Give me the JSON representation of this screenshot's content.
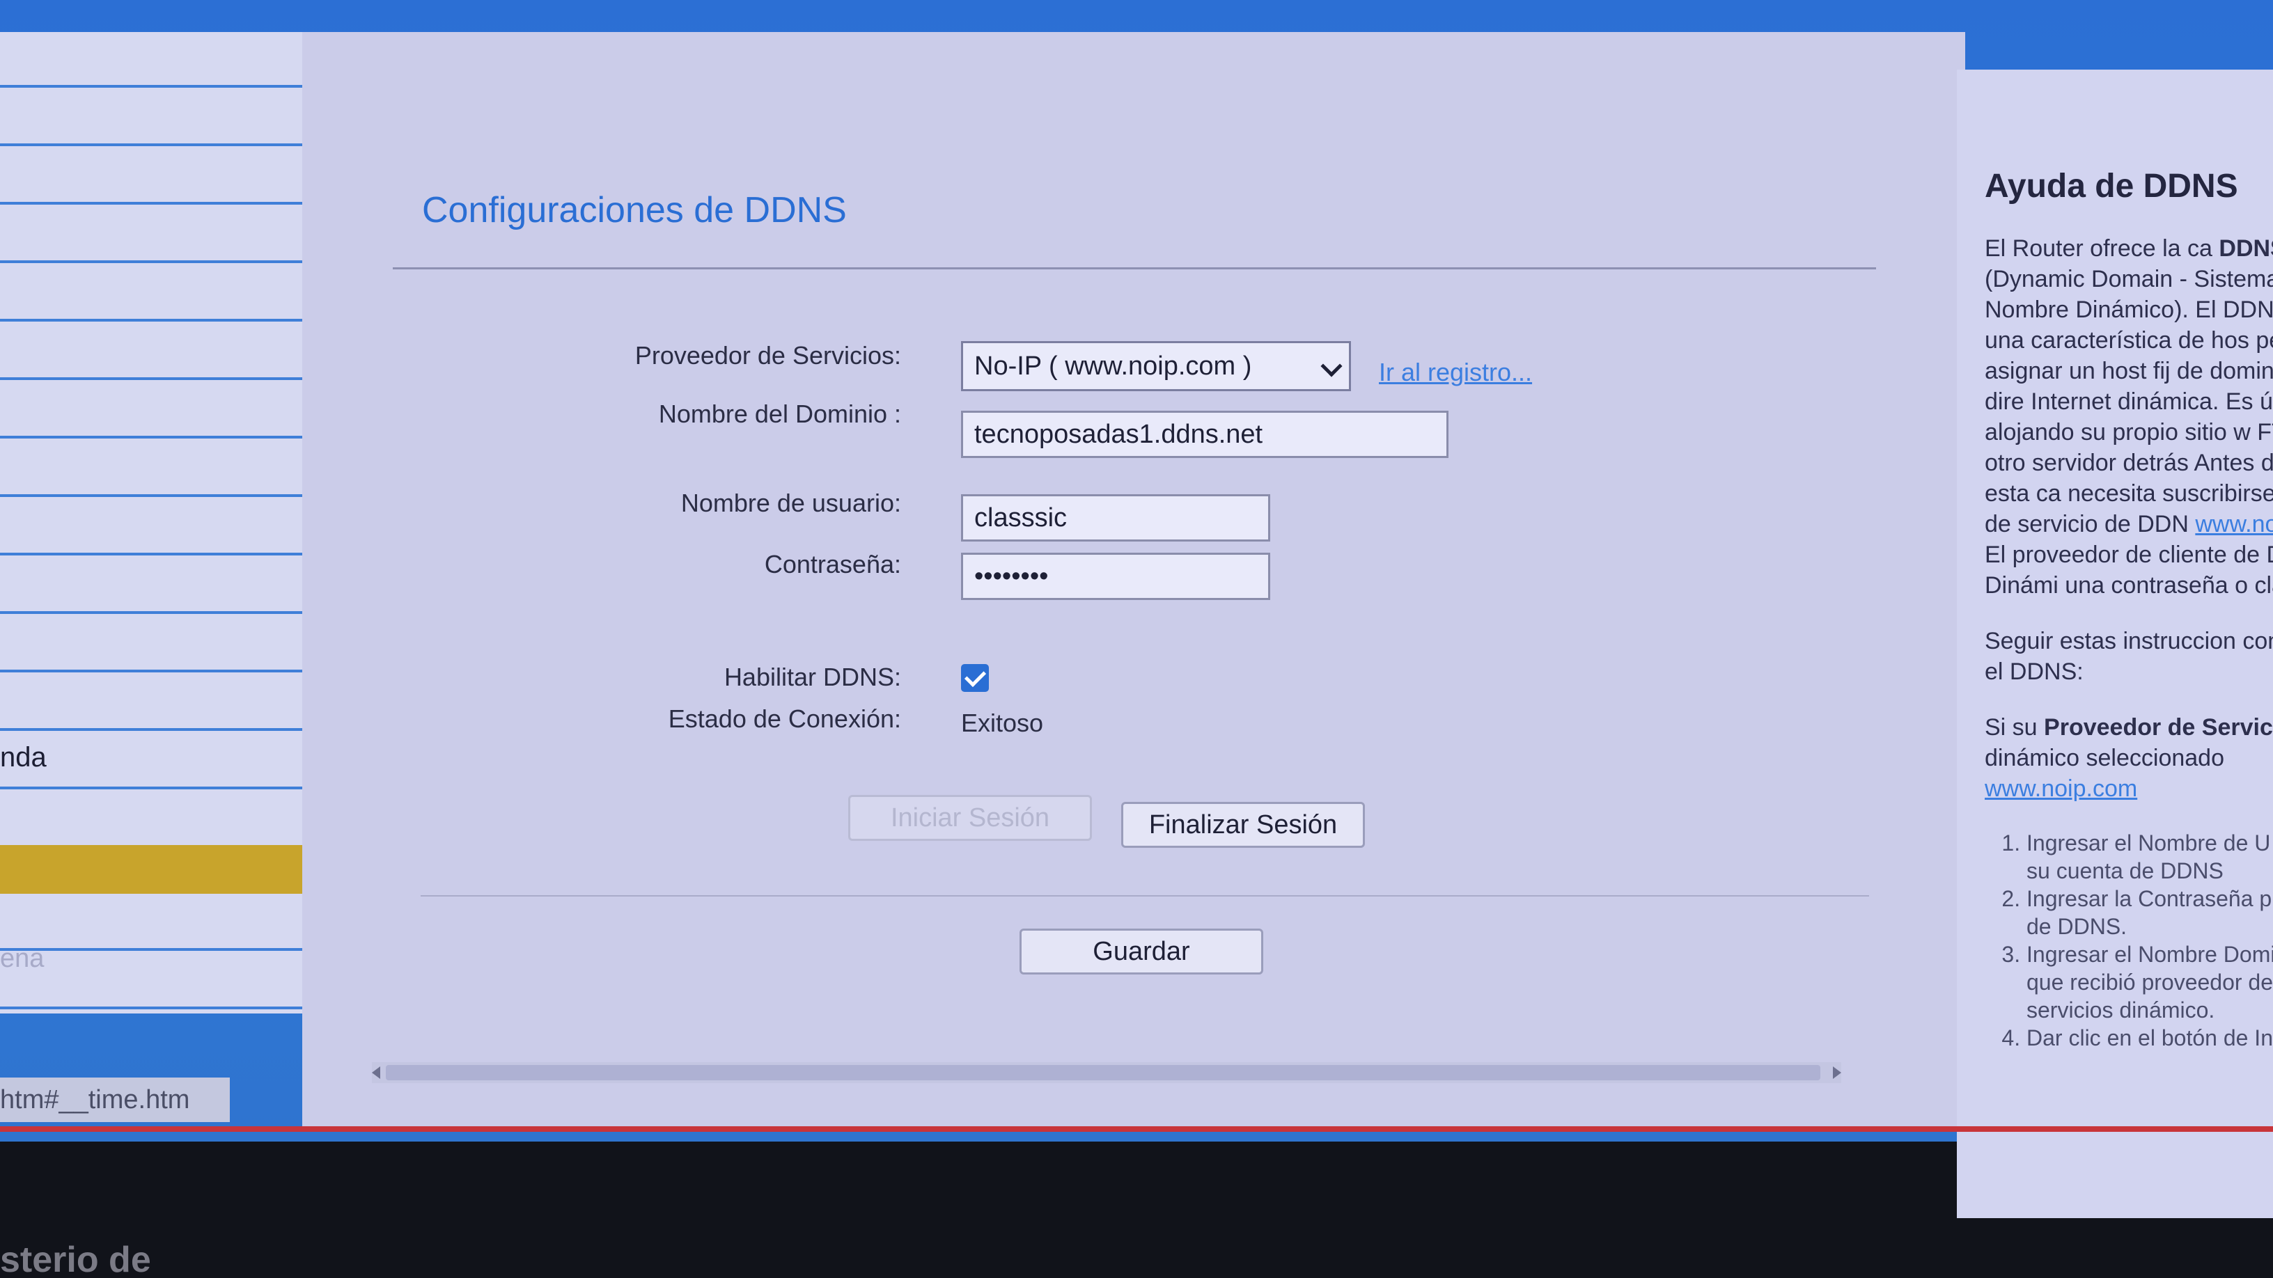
{
  "main": {
    "title": "Configuraciones de DDNS",
    "fields": {
      "provider_label": "Proveedor de Servicios:",
      "provider_value": "No-IP ( www.noip.com )",
      "register_link": "Ir al registro...",
      "domain_label": "Nombre del Dominio :",
      "domain_value": "tecnoposadas1.ddns.net",
      "username_label": "Nombre de usuario:",
      "username_value": "classsic",
      "password_label": "Contraseña:",
      "password_value": "••••••••",
      "enable_label": "Habilitar DDNS:",
      "enable_checked": true,
      "status_label": "Estado de Conexión:",
      "status_value": "Exitoso"
    },
    "buttons": {
      "login": "Iniciar Sesión",
      "logout": "Finalizar Sesión",
      "save": "Guardar"
    }
  },
  "sidebar": {
    "visible_label": "nda",
    "faded_label": "ena"
  },
  "status_bar": {
    "url": "htm#__time.htm"
  },
  "help": {
    "title": "Ayuda de DDNS",
    "paragraph1_start": "El Router ofrece la ca",
    "paragraph1_bold": "DDNS",
    "paragraph1_rest": " (Dynamic Domain - Sistema del Nombre Dinámico). El DDNS le p una característica de hos permite asignar un host fij de dominio a una dire Internet dinámica. Es útil alojando su propio sitio w FTP u otro servidor detrás Antes de usar esta ca necesita suscribirse con p de servicio de DDN ",
    "paragraph1_link": "www.noip.com",
    "paragraph1_end": ". El proveedor de cliente de DNS Dinámi una contraseña o clave.",
    "paragraph2": "Seguir estas instruccion configurar el DDNS:",
    "paragraph3_start": "Si su ",
    "paragraph3_bold": "Proveedor de Servicio",
    "paragraph3_rest": " dinámico seleccionado ",
    "paragraph3_link": "www.noip.com",
    "steps": [
      "Ingresar el Nombre de U para su cuenta de DDNS",
      "Ingresar la Contraseña p cuenta de DDNS.",
      "Ingresar el Nombre Dominio que recibió proveedor de servicios dinámico.",
      "Dar clic en el botón de In"
    ]
  },
  "desk": {
    "bottom_text": "sterio de"
  },
  "colors": {
    "accent": "#2a6ed4",
    "frame": "#2f78d8",
    "panel": "#cbcce9"
  }
}
